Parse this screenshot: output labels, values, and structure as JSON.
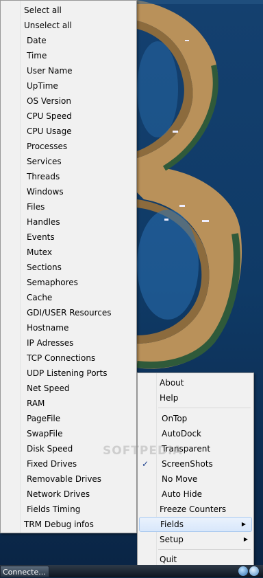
{
  "left_menu": {
    "items": [
      "Select all",
      "Unselect all",
      "Date",
      "Time",
      "User Name",
      "UpTime",
      "OS Version",
      "CPU Speed",
      "CPU Usage",
      "Processes",
      "Services",
      "Threads",
      "Windows",
      "Files",
      "Handles",
      "Events",
      "Mutex",
      "Sections",
      "Semaphores",
      "Cache",
      "GDI/USER Resources",
      "Hostname",
      "IP Adresses",
      "TCP Connections",
      "UDP Listening Ports",
      "Net Speed",
      "RAM",
      "PageFile",
      "SwapFile",
      "Disk Speed",
      "Fixed Drives",
      "Removable Drives",
      "Network Drives",
      "Fields Timing",
      "TRM Debug infos"
    ]
  },
  "right_menu": {
    "about": "About",
    "help": "Help",
    "ontop": "OnTop",
    "autodock": "AutoDock",
    "transparent": "Transparent",
    "screenshots": "ScreenShots",
    "screenshots_check": "✓",
    "nomove": "No Move",
    "autohide": "Auto Hide",
    "freeze": "Freeze Counters",
    "fields": "Fields",
    "setup": "Setup",
    "quit": "Quit",
    "arrow": "▶"
  },
  "taskbar": {
    "button_label": "Connecte..."
  },
  "watermark": "SOFTPEDIA"
}
